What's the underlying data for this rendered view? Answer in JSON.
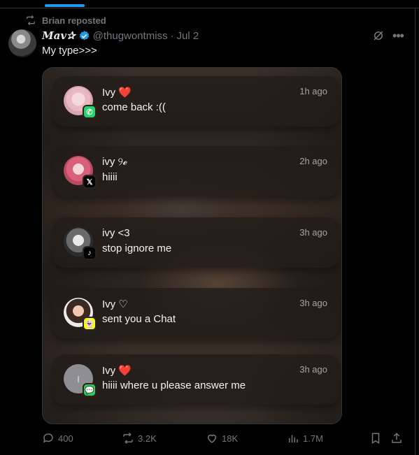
{
  "repost": {
    "text": "Brian reposted",
    "icon": "repost-icon"
  },
  "tweet": {
    "display_name": "𝑴𝒂𝒗✰",
    "handle": "@thugwontmiss",
    "separator": "·",
    "date": "Jul 2",
    "text": "My type>>>"
  },
  "notifications": [
    {
      "name": "Ivy",
      "emoji": "❤️",
      "message": "come back :((",
      "time": "1h ago",
      "app": "whatsapp-icon",
      "badge_glyph": "✆",
      "avatar_letter": ""
    },
    {
      "name": "ivy ୨ℯ",
      "emoji": "",
      "message": "hiiii",
      "time": "2h ago",
      "app": "x-icon",
      "badge_glyph": "𝕏",
      "avatar_letter": ""
    },
    {
      "name": "ivy <3",
      "emoji": "",
      "message": "stop ignore me",
      "time": "3h ago",
      "app": "tiktok-icon",
      "badge_glyph": "♪",
      "avatar_letter": ""
    },
    {
      "name": "Ivy",
      "emoji": "♡",
      "message": "sent you a Chat",
      "time": "3h ago",
      "app": "snapchat-icon",
      "badge_glyph": "👻",
      "avatar_letter": ""
    },
    {
      "name": "Ivy",
      "emoji": "❤️",
      "message": "hiiii where u please answer me",
      "time": "3h ago",
      "app": "messages-icon",
      "badge_glyph": "💬",
      "avatar_letter": "I"
    }
  ],
  "actions": {
    "replies": "400",
    "reposts": "3.2K",
    "likes": "18K",
    "views": "1.7M"
  },
  "colors": {
    "accent": "#1d9bf0",
    "muted": "#71767b",
    "text": "#e7e9ea",
    "heart": "#e1262d"
  }
}
